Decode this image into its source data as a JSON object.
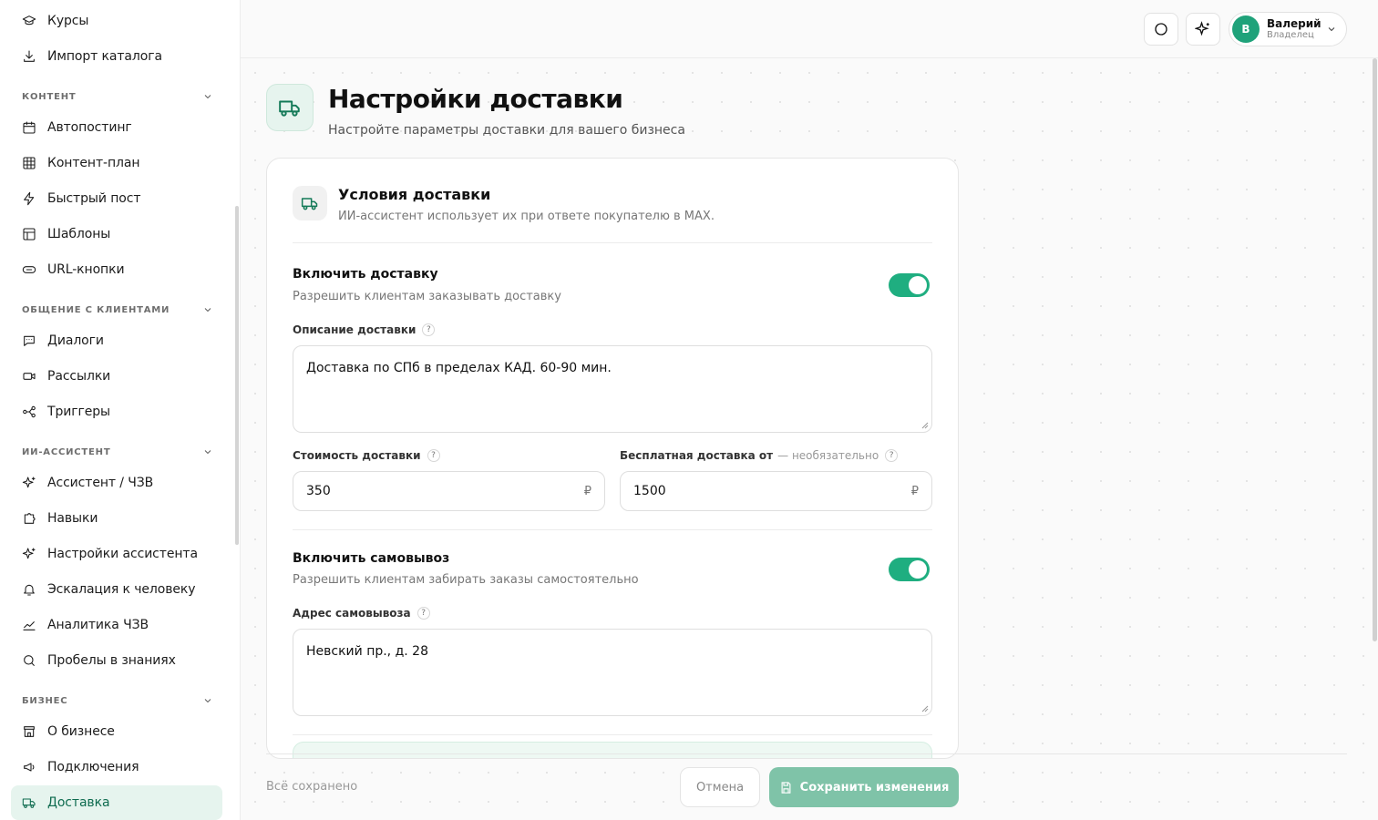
{
  "sidebar": {
    "top_items": [
      {
        "label": "Курсы",
        "icon": "graduation-cap-icon"
      },
      {
        "label": "Импорт каталога",
        "icon": "download-icon"
      }
    ],
    "sections": [
      {
        "title": "КОНТЕНТ",
        "items": [
          {
            "label": "Автопостинг",
            "icon": "calendar-clock-icon"
          },
          {
            "label": "Контент-план",
            "icon": "grid-calendar-icon"
          },
          {
            "label": "Быстрый пост",
            "icon": "lightning-icon"
          },
          {
            "label": "Шаблоны",
            "icon": "layout-template-icon"
          },
          {
            "label": "URL-кнопки",
            "icon": "link-button-icon"
          }
        ]
      },
      {
        "title": "ОБЩЕНИЕ С КЛИЕНТАМИ",
        "items": [
          {
            "label": "Диалоги",
            "icon": "chat-icon"
          },
          {
            "label": "Рассылки",
            "icon": "broadcast-icon"
          },
          {
            "label": "Триггеры",
            "icon": "workflow-icon"
          }
        ]
      },
      {
        "title": "ИИ-АССИСТЕНТ",
        "items": [
          {
            "label": "Ассистент / ЧЗВ",
            "icon": "sparkles-icon"
          },
          {
            "label": "Навыки",
            "icon": "puzzle-icon"
          },
          {
            "label": "Настройки ассистента",
            "icon": "sparkles-icon"
          },
          {
            "label": "Эскалация к человеку",
            "icon": "bell-icon"
          },
          {
            "label": "Аналитика ЧЗВ",
            "icon": "chart-line-icon"
          },
          {
            "label": "Пробелы в знаниях",
            "icon": "search-icon"
          }
        ]
      },
      {
        "title": "БИЗНЕС",
        "items": [
          {
            "label": "О бизнесе",
            "icon": "store-icon"
          },
          {
            "label": "Подключения",
            "icon": "megaphone-icon"
          },
          {
            "label": "Доставка",
            "icon": "truck-icon",
            "active": true
          }
        ]
      }
    ]
  },
  "topbar": {
    "user": {
      "initial": "В",
      "name": "Валерий",
      "role": "Владелец"
    }
  },
  "page": {
    "title": "Настройки доставки",
    "subtitle": "Настройте параметры доставки для вашего бизнеса"
  },
  "card": {
    "title": "Условия доставки",
    "subtitle": "ИИ-ассистент использует их при ответе покупателю в MAX.",
    "delivery": {
      "title": "Включить доставку",
      "subtitle": "Разрешить клиентам заказывать доставку",
      "enabled": true,
      "description_label": "Описание доставки",
      "description_value": "Доставка по СПб в пределах КАД. 60-90 мин.",
      "cost_label": "Стоимость доставки",
      "cost_value": "350",
      "free_label": "Бесплатная доставка от",
      "free_optional": "— необязательно",
      "free_value": "1500",
      "currency": "₽"
    },
    "pickup": {
      "title": "Включить самовывоз",
      "subtitle": "Разрешить клиентам забирать заказы самостоятельно",
      "enabled": true,
      "address_label": "Адрес самовывоза",
      "address_value": "Невский пр., д. 28"
    },
    "help_glyph": "?"
  },
  "footer": {
    "status": "Всё сохранено",
    "cancel": "Отмена",
    "save": "Сохранить изменения"
  },
  "colors": {
    "accent": "#1fae80",
    "active_bg": "#e6f4ee",
    "active_text": "#0e6b4f",
    "save_disabled": "#7fc3a8"
  }
}
